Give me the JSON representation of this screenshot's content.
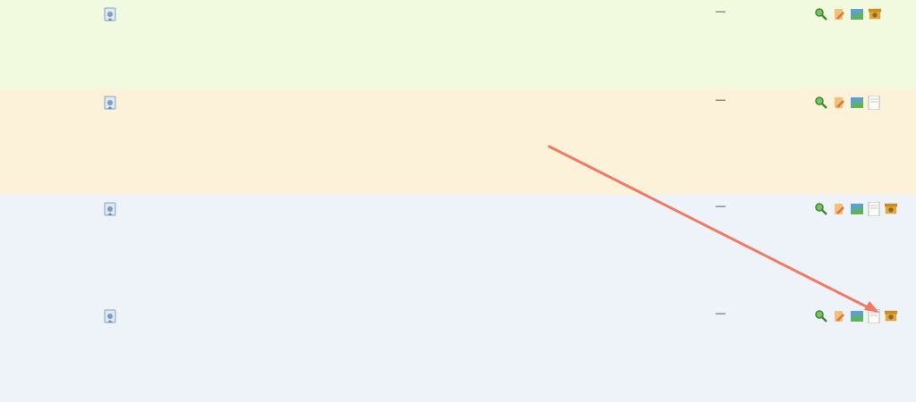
{
  "colors": {
    "row_green": "#f1fadf",
    "row_peach": "#fbf2d9",
    "row_blue": "#eef3fa",
    "annotation": "#f07a63"
  },
  "icons": [
    "certificate-icon",
    "search-icon",
    "edit-icon",
    "map-icon",
    "document-icon",
    "archive-icon"
  ],
  "rows": [
    {
      "id": "",
      "org": [
        "",
        "",
        "",
        "",
        ""
      ],
      "desc": [
        "",
        "",
        "",
        "",
        "",
        ""
      ],
      "num": "",
      "date": [
        "",
        "",
        "",
        ""
      ],
      "dash": "—",
      "status": [
        "",
        ""
      ],
      "actions": [
        "search-icon",
        "edit-icon",
        "map-icon",
        "archive-icon"
      ]
    },
    {
      "id": "",
      "org": [
        "",
        "",
        "",
        "",
        ""
      ],
      "desc": [
        "",
        "",
        "",
        "",
        "",
        "",
        "",
        ""
      ],
      "num": "",
      "date": [
        "",
        ""
      ],
      "dash": "—",
      "status": [
        "",
        "",
        ""
      ],
      "actions": [
        "search-icon",
        "edit-icon",
        "map-icon",
        "document-icon"
      ]
    },
    {
      "id": "",
      "org": [
        "",
        "",
        "",
        "",
        ""
      ],
      "desc": [
        "",
        "",
        "",
        "",
        "",
        "",
        "",
        ""
      ],
      "num": "",
      "date": [
        "",
        ""
      ],
      "dash": "—",
      "status": [
        "",
        ""
      ],
      "actions": [
        "search-icon",
        "edit-icon",
        "map-icon",
        "document-icon",
        "archive-icon"
      ]
    },
    {
      "id": "",
      "org": [
        "",
        "",
        "",
        "",
        ""
      ],
      "desc": [
        "",
        "",
        "",
        "",
        "",
        "",
        "",
        ""
      ],
      "num": "",
      "date": [
        "",
        ""
      ],
      "dash": "—",
      "status": [
        "",
        ""
      ],
      "actions": [
        "search-icon",
        "edit-icon",
        "map-icon",
        "document-icon",
        "archive-icon"
      ]
    }
  ]
}
